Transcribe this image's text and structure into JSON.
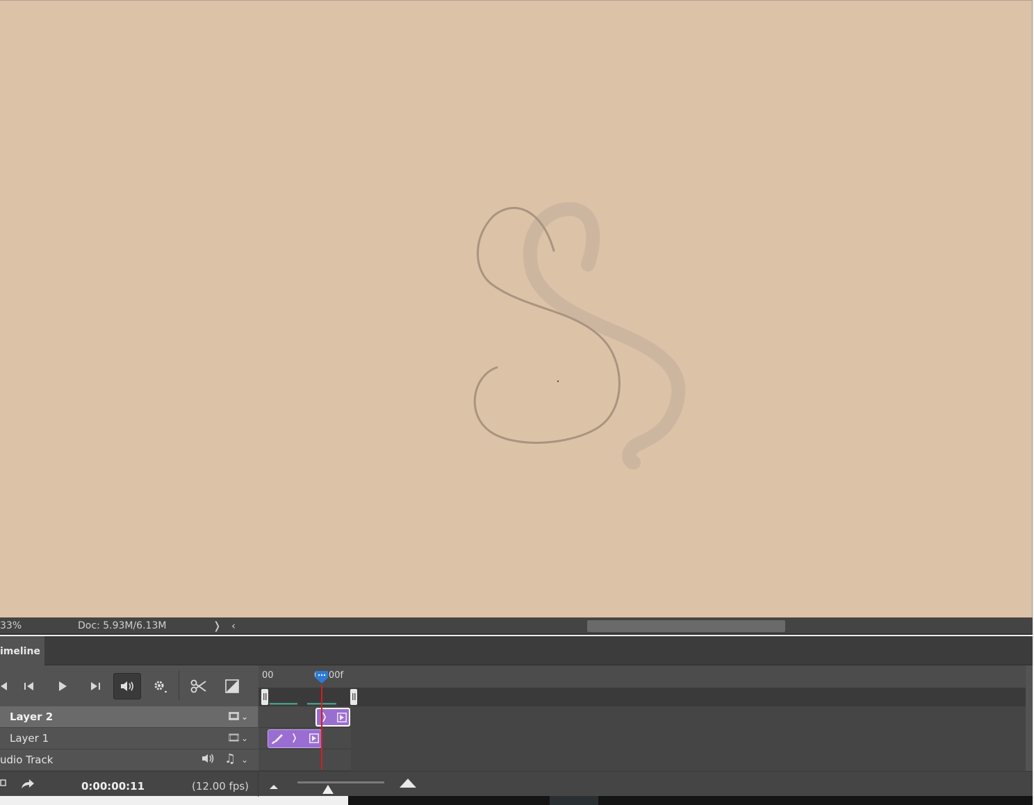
{
  "status_bar": {
    "zoom": "33%",
    "doc_size": "Doc: 5.93M/6.13M",
    "more_arrow": "❭",
    "scroll_left_arrow": "‹"
  },
  "panel": {
    "tab_label": "imeline"
  },
  "timeline": {
    "ruler": {
      "start_label": "00",
      "end_label": "01:00f"
    },
    "tracks": [
      {
        "name": "Layer 2",
        "selected": true
      },
      {
        "name": "Layer 1",
        "selected": false
      },
      {
        "name": "udio Track",
        "selected": false
      }
    ],
    "current_time": "0:00:00:11",
    "fps": "(12.00 fps)",
    "zoom_level": 0.35
  },
  "colors": {
    "canvas_bg": "#dcc2a7",
    "stroke": "#a89480",
    "clip": "#9a6ed0",
    "playhead": "#d32020",
    "playhead_head": "#2e7ad6"
  }
}
